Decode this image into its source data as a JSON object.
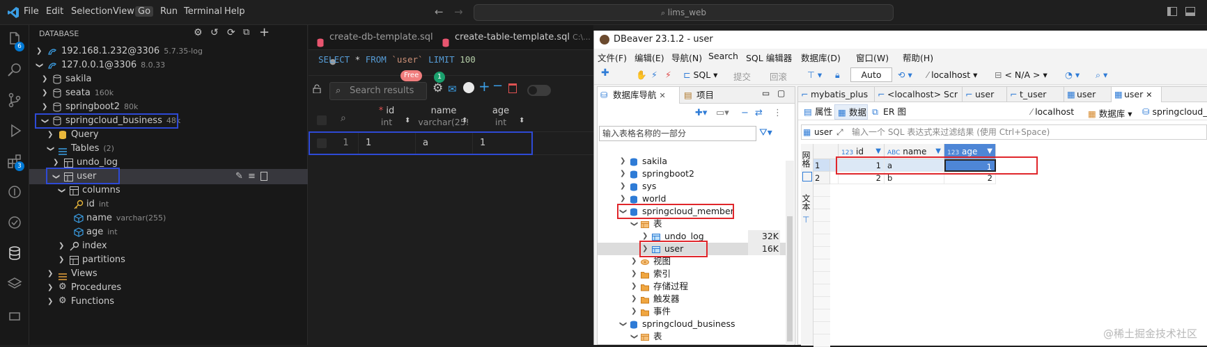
{
  "vscode": {
    "menu": [
      "File",
      "Edit",
      "Selection",
      "View",
      "Go",
      "Run",
      "Terminal",
      "Help"
    ],
    "active_menu": "Go",
    "command_center": "lims_web",
    "activity_badges": {
      "explorer": "6",
      "extensions": "3"
    },
    "sidebar": {
      "title": "DATABASE",
      "connections": [
        {
          "label": "192.168.1.232@3306",
          "version": "5.7.35-log"
        },
        {
          "label": "127.0.0.1@3306",
          "version": "8.0.33"
        }
      ],
      "databases": [
        {
          "label": "sakila",
          "size": ""
        },
        {
          "label": "seata",
          "size": "160k"
        },
        {
          "label": "springboot2",
          "size": "80k"
        },
        {
          "label": "springcloud_business",
          "size": "48k"
        }
      ],
      "query": "Query",
      "tables": {
        "label": "Tables",
        "count": "(2)"
      },
      "undo_log": "undo_log",
      "user": "user",
      "columns": "columns",
      "cols": [
        {
          "name": "id",
          "type": "int"
        },
        {
          "name": "name",
          "type": "varchar(255)"
        },
        {
          "name": "age",
          "type": "int"
        }
      ],
      "index": "index",
      "partitions": "partitions",
      "views": "Views",
      "procedures": "Procedures",
      "functions": "Functions"
    },
    "tabs": [
      {
        "label": "create-db-template.sql",
        "dot": "●"
      },
      {
        "label": "create-table-template.sql",
        "path": "C:\\..."
      }
    ],
    "sql": {
      "select": "SELECT",
      "star": " * ",
      "from": "FROM",
      "table": " `user` ",
      "limit": "LIMIT",
      "n": " 100"
    },
    "results": {
      "search_placeholder": "Search results",
      "free_badge": "Free",
      "mail_badge": "1",
      "columns": [
        {
          "name": "id",
          "type": "int",
          "required": "*"
        },
        {
          "name": "name",
          "type": "varchar(25!"
        },
        {
          "name": "age",
          "type": "int"
        }
      ],
      "rows": [
        {
          "rownum": "1",
          "id": "1",
          "name": "a",
          "age": "1"
        }
      ]
    }
  },
  "dbeaver": {
    "title": "DBeaver 23.1.2 - user",
    "menu": [
      "文件(F)",
      "编辑(E)",
      "导航(N)",
      "Search",
      "SQL 编辑器",
      "数据库(D)",
      "窗口(W)",
      "帮助(H)"
    ],
    "toolbar": {
      "sql": "SQL",
      "commit": "提交",
      "rollback": "回滚",
      "mode": "Auto",
      "host": "localhost",
      "schema": "< N/A >"
    },
    "nav_tabs": [
      "数据库导航",
      "项目"
    ],
    "nav_filter_placeholder": "输入表格名称的一部分",
    "nav_tree": [
      {
        "label": "sakila"
      },
      {
        "label": "springboot2"
      },
      {
        "label": "sys"
      },
      {
        "label": "world"
      },
      {
        "label": "springcloud_member"
      },
      {
        "label": "表"
      },
      {
        "label": "undo_log",
        "size": "32K"
      },
      {
        "label": "user",
        "size": "16K"
      },
      {
        "label": "视图"
      },
      {
        "label": "索引"
      },
      {
        "label": "存储过程"
      },
      {
        "label": "触发器"
      },
      {
        "label": "事件"
      },
      {
        "label": "springcloud_business"
      },
      {
        "label": "表"
      }
    ],
    "editor_tabs": [
      "mybatis_plus",
      "<localhost> Scr",
      "user",
      "t_user",
      "user",
      "user"
    ],
    "sub_tabs": [
      "属性",
      "数据",
      "ER 图"
    ],
    "sub_right": {
      "host": "localhost",
      "db": "数据库",
      "schema": "springcloud_..."
    },
    "filter": {
      "table": "user",
      "placeholder": "输入一个 SQL 表达式来过滤结果 (使用 Ctrl+Space)"
    },
    "vtabs": {
      "grid": "网格",
      "text": "文本"
    },
    "grid": {
      "columns": [
        {
          "prefix": "123",
          "name": "id"
        },
        {
          "prefix": "ABC",
          "name": "name"
        },
        {
          "prefix": "123",
          "name": "age"
        }
      ],
      "rows": [
        {
          "n": "1",
          "id": "1",
          "name": "a",
          "age": "1"
        },
        {
          "n": "2",
          "id": "2",
          "name": "b",
          "age": "2"
        }
      ]
    }
  },
  "watermark": "@稀土掘金技术社区",
  "colors": {
    "accent_blue": "#2e4ad6",
    "accent_red": "#e0262b",
    "vscode_bg": "#1e1e1e",
    "dbeaver_bg": "#f3f3f3"
  }
}
